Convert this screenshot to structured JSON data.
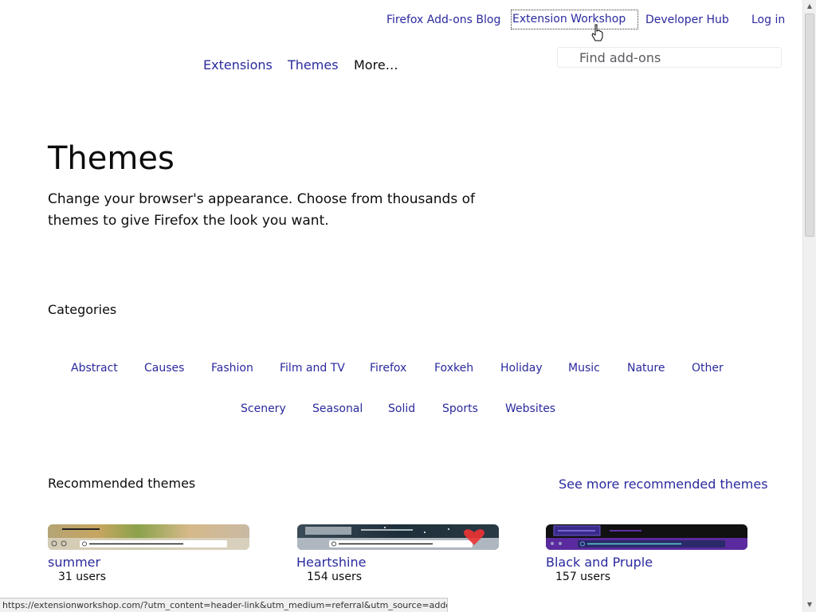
{
  "header": {
    "blog": "Firefox Add-ons Blog",
    "workshop": "Extension Workshop",
    "devhub": "Developer Hub",
    "login": "Log in"
  },
  "nav": {
    "extensions": "Extensions",
    "themes": "Themes",
    "more": "More…"
  },
  "search": {
    "placeholder": "Find add-ons"
  },
  "page": {
    "title": "Themes",
    "description": "Change your browser's appearance. Choose from thousands of themes to give Firefox the look you want."
  },
  "categories": {
    "heading": "Categories",
    "items": [
      "Abstract",
      "Causes",
      "Fashion",
      "Film and TV",
      "Firefox",
      "Foxkeh",
      "Holiday",
      "Music",
      "Nature",
      "Other",
      "Scenery",
      "Seasonal",
      "Solid",
      "Sports",
      "Websites"
    ]
  },
  "recommended": {
    "heading": "Recommended themes",
    "see_more": "See more recommended themes",
    "themes": [
      {
        "name": "summer",
        "users": "31 users"
      },
      {
        "name": "Heartshine",
        "users": "154 users"
      },
      {
        "name": "Black and Pruple",
        "users": "157 users"
      }
    ]
  },
  "statusbar": {
    "url": "https://extensionworkshop.com/?utm_content=header-link&utm_medium=referral&utm_source=addons.mozilla.org"
  },
  "colors": {
    "link": "#2a2a9e",
    "text": "#0c0c0d"
  }
}
